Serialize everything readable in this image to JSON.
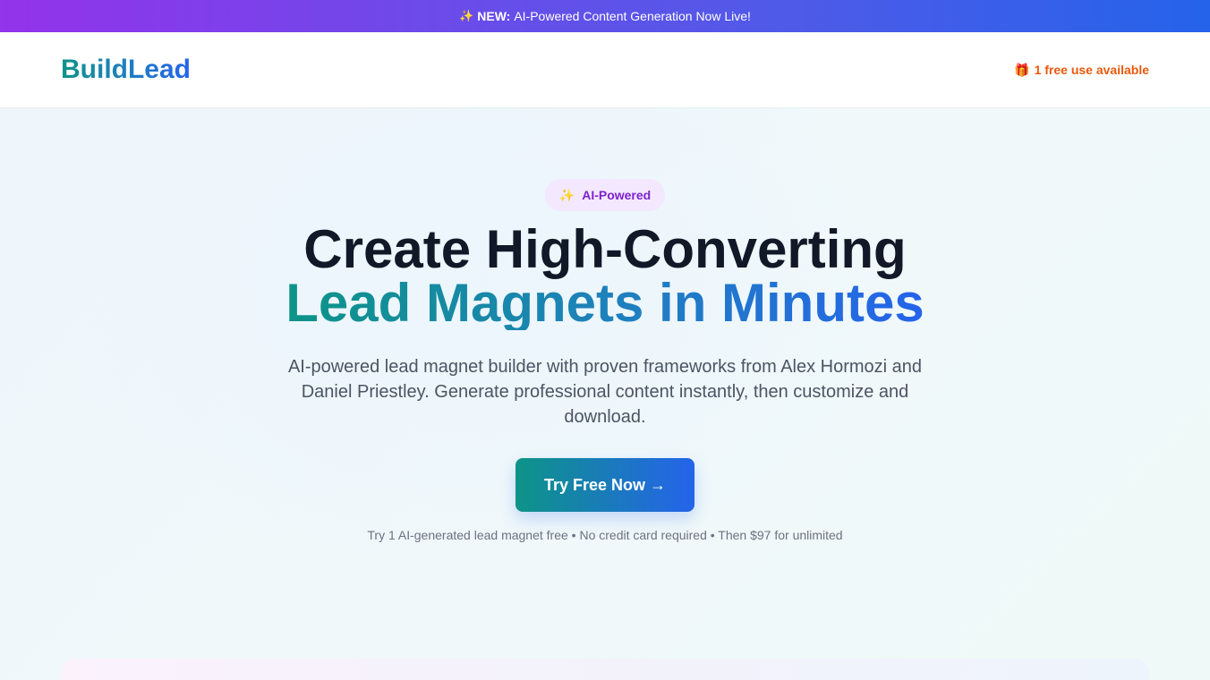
{
  "announcement": {
    "sparkle_icon": "✨",
    "badge": "NEW:",
    "text": "AI-Powered Content Generation Now Live!"
  },
  "header": {
    "logo": "BuildLead",
    "gift_icon": "🎁",
    "free_use": "1 free use available"
  },
  "hero": {
    "pill_icon": "✨",
    "pill_label": "AI-Powered",
    "headline_line1": "Create High-Converting",
    "headline_line2": "Lead Magnets in Minutes",
    "subtext": "AI-powered lead magnet builder with proven frameworks from Alex Hormozi and Daniel Priestley. Generate professional content instantly, then customize and download.",
    "cta_label": "Try Free Now →",
    "fineprint": "Try 1 AI-generated lead magnet free • No credit card required • Then $97 for unlimited"
  },
  "colors": {
    "accent_teal": "#0d9488",
    "accent_blue": "#2563eb",
    "accent_purple": "#9333ea",
    "free_use_orange": "#ea580c"
  }
}
